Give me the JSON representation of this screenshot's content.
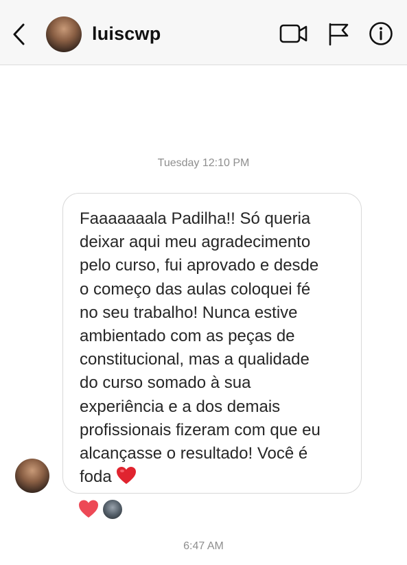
{
  "header": {
    "username": "luiscwp",
    "icons": [
      "back-chevron-icon",
      "video-call-icon",
      "flag-icon",
      "info-icon"
    ]
  },
  "conversation": {
    "timestamp_top": "Tuesday 12:10 PM",
    "message": {
      "text": "Faaaaaaala Padilha!! Só queria\ndeixar aqui meu agradecimento\npelo curso, fui aprovado e desde\no começo das aulas coloquei fé\nno seu trabalho! Nunca estive\nambientado com as peças de\nconstitucional, mas a qualidade\ndo curso somado à sua\nexperiência e a dos demais\nprofissionais fizeram com que eu\nalcançasse o resultado! Você é\nfoda",
      "emoji": "red-heart"
    },
    "reaction": "red-heart",
    "timestamp_bottom": "6:47 AM"
  },
  "colors": {
    "heart": "#ed4956",
    "meta_text": "#8e8e8e",
    "bubble_border": "#d8d8d8"
  }
}
